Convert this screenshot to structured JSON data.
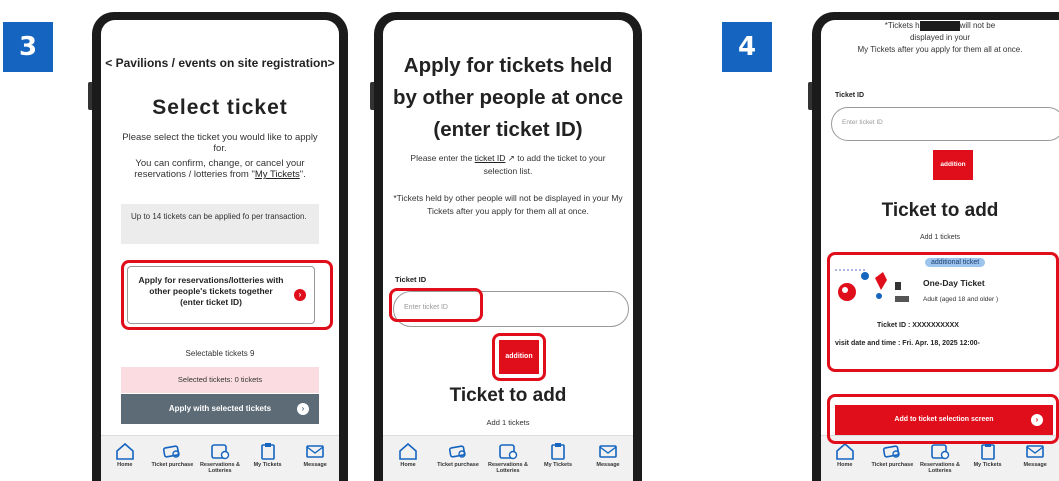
{
  "steps": [
    "3",
    "4"
  ],
  "nav_items": [
    {
      "label": "Home",
      "icon": "home-icon"
    },
    {
      "label": "Ticket purchase",
      "icon": "ticket-icon"
    },
    {
      "label": "Reservations & Lotteries",
      "icon": "calendar-icon"
    },
    {
      "label": "My Tickets",
      "icon": "clipboard-icon"
    },
    {
      "label": "Message",
      "icon": "mail-icon"
    }
  ],
  "screen1": {
    "breadcrumb": "< Pavilions / events on site registration>",
    "title": "Select ticket",
    "desc": "Please select the ticket you would like to apply for.",
    "desc2_prefix": "You can confirm, change, or cancel your reservations / lotteries from \"",
    "desc2_link": "My Tickets",
    "desc2_suffix": "\".",
    "note": "Up to 14 tickets can be applied fo per transaction.",
    "apply_together": "Apply for reservations/lotteries with other people's tickets together (enter ticket ID)",
    "selectable": "Selectable tickets 9",
    "selected": "Selected tickets: 0 tickets",
    "apply_selected": "Apply with selected tickets"
  },
  "screen2": {
    "title": "Apply for tickets held by other people at once (enter ticket ID)",
    "text1_prefix": "Please enter the ",
    "text1_link": "ticket ID",
    "text1_suffix": " to add the ticket to your selection list.",
    "text2": "*Tickets held by other people will not be displayed in your My Tickets after you apply for them all at once.",
    "id_label": "Ticket ID",
    "id_placeholder": "Enter ticket ID",
    "add_button": "addition",
    "ticket_title": "Ticket to add",
    "add_count": "Add 1 tickets"
  },
  "screen3": {
    "top_prefix": "*Tickets h",
    "top_suffix": "will not be",
    "top_line2": "displayed in your",
    "top_line3": "My Tickets after you apply for them all at once.",
    "id_label": "Ticket ID",
    "id_placeholder": "Enter ticket ID",
    "add_button": "addition",
    "ticket_title": "Ticket to add",
    "add_count": "Add 1 tickets",
    "tag": "additional ticket",
    "ticket_name": "One-Day Ticket",
    "ticket_type": "Adult (aged 18 and older )",
    "ticket_id": "Ticket ID : XXXXXXXXXX",
    "visit": "visit date and time : Fri. Apr. 18, 2025 12:00-",
    "add_to_selection": "Add to ticket selection screen"
  },
  "colors": {
    "step_blue": "#1565c0",
    "accent_red": "#e00d1a",
    "gray_button": "#5d6b77"
  }
}
